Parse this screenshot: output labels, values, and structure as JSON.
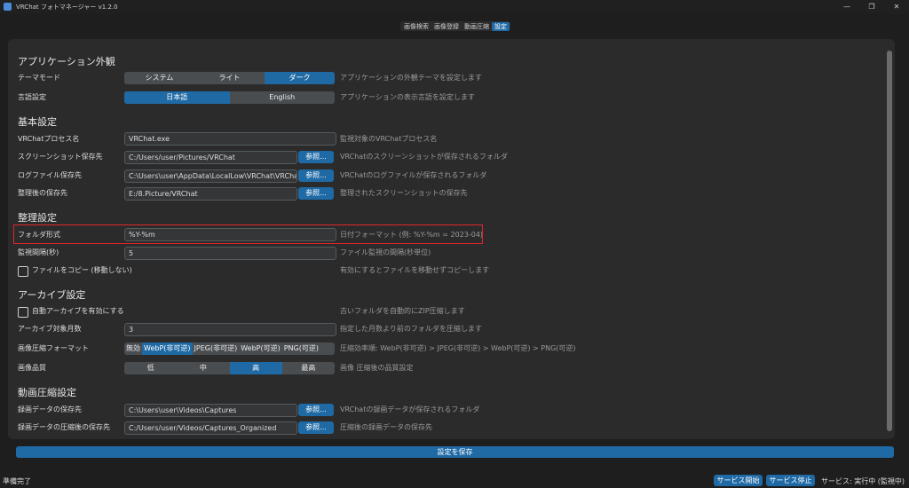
{
  "window": {
    "title": "VRChat フォトマネージャー v1.2.0",
    "controls": {
      "minimize": "—",
      "maximize": "❐",
      "close": "✕"
    }
  },
  "tabs": [
    {
      "label": "画像検索",
      "active": false
    },
    {
      "label": "画像登録",
      "active": false
    },
    {
      "label": "動画圧縮",
      "active": false
    },
    {
      "label": "設定",
      "active": true
    }
  ],
  "appearance": {
    "heading": "アプリケーション外観",
    "theme": {
      "label": "テーマモード",
      "options": [
        "システム",
        "ライト",
        "ダーク"
      ],
      "selected": "ダーク",
      "desc": "アプリケーションの外観テーマを設定します"
    },
    "language": {
      "label": "言語設定",
      "options": [
        "日本語",
        "English"
      ],
      "selected": "日本語",
      "desc": "アプリケーションの表示言語を設定します"
    }
  },
  "basic": {
    "heading": "基本設定",
    "process": {
      "label": "VRChatプロセス名",
      "value": "VRChat.exe",
      "desc": "監視対象のVRChatプロセス名"
    },
    "screenshot": {
      "label": "スクリーンショット保存先",
      "value": "C:/Users/user/Pictures/VRChat",
      "button": "参照...",
      "desc": "VRChatのスクリーンショットが保存されるフォルダ"
    },
    "logfile": {
      "label": "ログファイル保存先",
      "value": "C:\\Users\\user\\AppData\\LocalLow\\VRChat\\VRChat",
      "button": "参照...",
      "desc": "VRChatのログファイルが保存されるフォルダ"
    },
    "organized": {
      "label": "整理後の保存先",
      "value": "E:/8.Picture/VRChat",
      "button": "参照...",
      "desc": "整理されたスクリーンショットの保存先"
    }
  },
  "organize": {
    "heading": "整理設定",
    "folder_format": {
      "label": "フォルダ形式",
      "value": "%Y-%m",
      "desc": "日付フォーマット (例: %Y-%m = 2023-04)"
    },
    "interval": {
      "label": "監視間隔(秒)",
      "value": "5",
      "desc": "ファイル監視の間隔(秒単位)"
    },
    "copy": {
      "label": "ファイルをコピー (移動しない)",
      "checked": false,
      "desc": "有効にするとファイルを移動せずコピーします"
    }
  },
  "archive": {
    "heading": "アーカイブ設定",
    "auto": {
      "label": "自動アーカイブを有効にする",
      "checked": false,
      "desc": "古いフォルダを自動的にZIP圧縮します"
    },
    "months": {
      "label": "アーカイブ対象月数",
      "value": "3",
      "desc": "指定した月数より前のフォルダを圧縮します"
    },
    "format": {
      "label": "画像圧縮フォーマット",
      "options": [
        "無効",
        "WebP(非可逆)",
        "JPEG(非可逆)",
        "WebP(可逆)",
        "PNG(可逆)"
      ],
      "selected": "WebP(非可逆)",
      "desc": "圧縮効率順: WebP(非可逆) > JPEG(非可逆) > WebP(可逆) > PNG(可逆)"
    },
    "quality": {
      "label": "画像品質",
      "options": [
        "低",
        "中",
        "高",
        "最高"
      ],
      "selected": "高",
      "desc": "画像 圧縮後の品質設定"
    }
  },
  "video": {
    "heading": "動画圧縮設定",
    "source": {
      "label": "録画データの保存先",
      "value": "C:\\Users\\user\\Videos\\Captures",
      "button": "参照...",
      "desc": "VRChatの録画データが保存されるフォルダ"
    },
    "dest": {
      "label": "録画データの圧縮後の保存先",
      "value": "C:/Users/user/Videos/Captures_Organized",
      "button": "参照...",
      "desc": "圧縮後の録画データの保存先"
    }
  },
  "save_button": "設定を保存",
  "status": {
    "left": "準備完了",
    "start": "サービス開始",
    "stop": "サービス停止",
    "service": "サービス: 実行中 (監視中)"
  },
  "colors": {
    "accent": "#1f6aa5",
    "highlight": "#e0262b",
    "background": "#1e1e1e",
    "panel": "#2b2b2b"
  }
}
